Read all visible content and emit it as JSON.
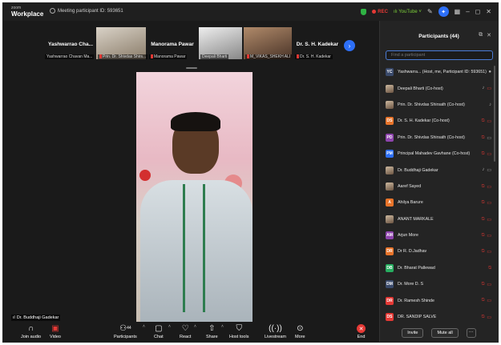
{
  "topbar": {
    "logo_top": "zoom",
    "logo_bottom": "Workplace",
    "meeting_id": "Meeting participant ID: 593651",
    "rec_label": "REC",
    "youtube_label": "YouTube",
    "colors": {
      "rec": "#e53935",
      "youtube": "#7ccf3a",
      "accent": "#2d6ff7",
      "shield": "#2fb344"
    }
  },
  "gallery": [
    {
      "name": "Yashwarrao Cha...",
      "caption": "Yashwarrao Chavan Ma..."
    },
    {
      "name": "",
      "caption": "Prin. Dr. Shivdas Shirs..."
    },
    {
      "name": "Manorama Pawar",
      "caption": "Manorama Pawar"
    },
    {
      "name": "",
      "caption": "Deepali Bharti"
    },
    {
      "name": "",
      "caption": "M_VIKAS_SHEKH ALI"
    },
    {
      "name": "Dr. S. H. Kadekar",
      "caption": "Dr. S. H. Kadekar"
    }
  ],
  "main_video": {
    "speaker": "Dr. Buddhaji Gadekar"
  },
  "toolbar": {
    "join_audio": "Join audio",
    "video": "Video",
    "participants": "Participants",
    "participants_count": "44",
    "chat": "Chat",
    "react": "React",
    "share": "Share",
    "host_tools": "Host tools",
    "livestream": "Livestream",
    "more": "More",
    "end": "End"
  },
  "panel": {
    "title": "Participants (44)",
    "search_placeholder": "Find a participant",
    "participants": [
      {
        "initials": "YC",
        "name": "Yashwarra...   (Host, me, Participant ID: 593651)",
        "color": "#3a4a6b",
        "mic": "none",
        "cam": "none"
      },
      {
        "initials": "",
        "name": "Deepali Bharti (Co-host)",
        "color": "",
        "mic": "on",
        "cam": "off"
      },
      {
        "initials": "",
        "name": "Prin. Dr. Shivdas Shirsath (Co-host)",
        "color": "",
        "mic": "on",
        "cam": "none"
      },
      {
        "initials": "DS",
        "name": "Dr. S. H. Kadekar (Co-host)",
        "color": "#e8742a",
        "mic": "off",
        "cam": "off"
      },
      {
        "initials": "PD",
        "name": "Prin. Dr. Shivdas Shirsath (Co-host)",
        "color": "#8e44ad",
        "mic": "off",
        "cam": "on"
      },
      {
        "initials": "PM",
        "name": "Principal Mahadev Gavhane (Co-host)",
        "color": "#2d6ff7",
        "mic": "off",
        "cam": "off"
      },
      {
        "initials": "",
        "name": "Dr. Buddhaji Gadekar",
        "color": "",
        "mic": "on",
        "cam": "on"
      },
      {
        "initials": "",
        "name": "Aaref Sayed",
        "color": "",
        "mic": "off",
        "cam": "off"
      },
      {
        "initials": "A",
        "name": "Ahilya   Barure",
        "color": "#e8742a",
        "mic": "off",
        "cam": "off"
      },
      {
        "initials": "",
        "name": "ANANT MARKALE",
        "color": "",
        "mic": "off",
        "cam": "off"
      },
      {
        "initials": "AM",
        "name": "Arjun More",
        "color": "#8e44ad",
        "mic": "off",
        "cam": "off"
      },
      {
        "initials": "DR",
        "name": "Dr R. D.Jadhav",
        "color": "#e8742a",
        "mic": "off",
        "cam": "off"
      },
      {
        "initials": "DB",
        "name": "Dr. Bharat Pallewad",
        "color": "#27ae60",
        "mic": "off",
        "cam": "none"
      },
      {
        "initials": "DM",
        "name": "Dr. More D. S",
        "color": "#3a4a6b",
        "mic": "off",
        "cam": "off"
      },
      {
        "initials": "DR",
        "name": "Dr. Ramesh Shinde",
        "color": "#e53935",
        "mic": "off",
        "cam": "off"
      },
      {
        "initials": "DS",
        "name": "DR. SANDIP SALVE",
        "color": "#e53935",
        "mic": "off",
        "cam": "off"
      }
    ],
    "invite_label": "Invite",
    "mute_all_label": "Mute all"
  }
}
